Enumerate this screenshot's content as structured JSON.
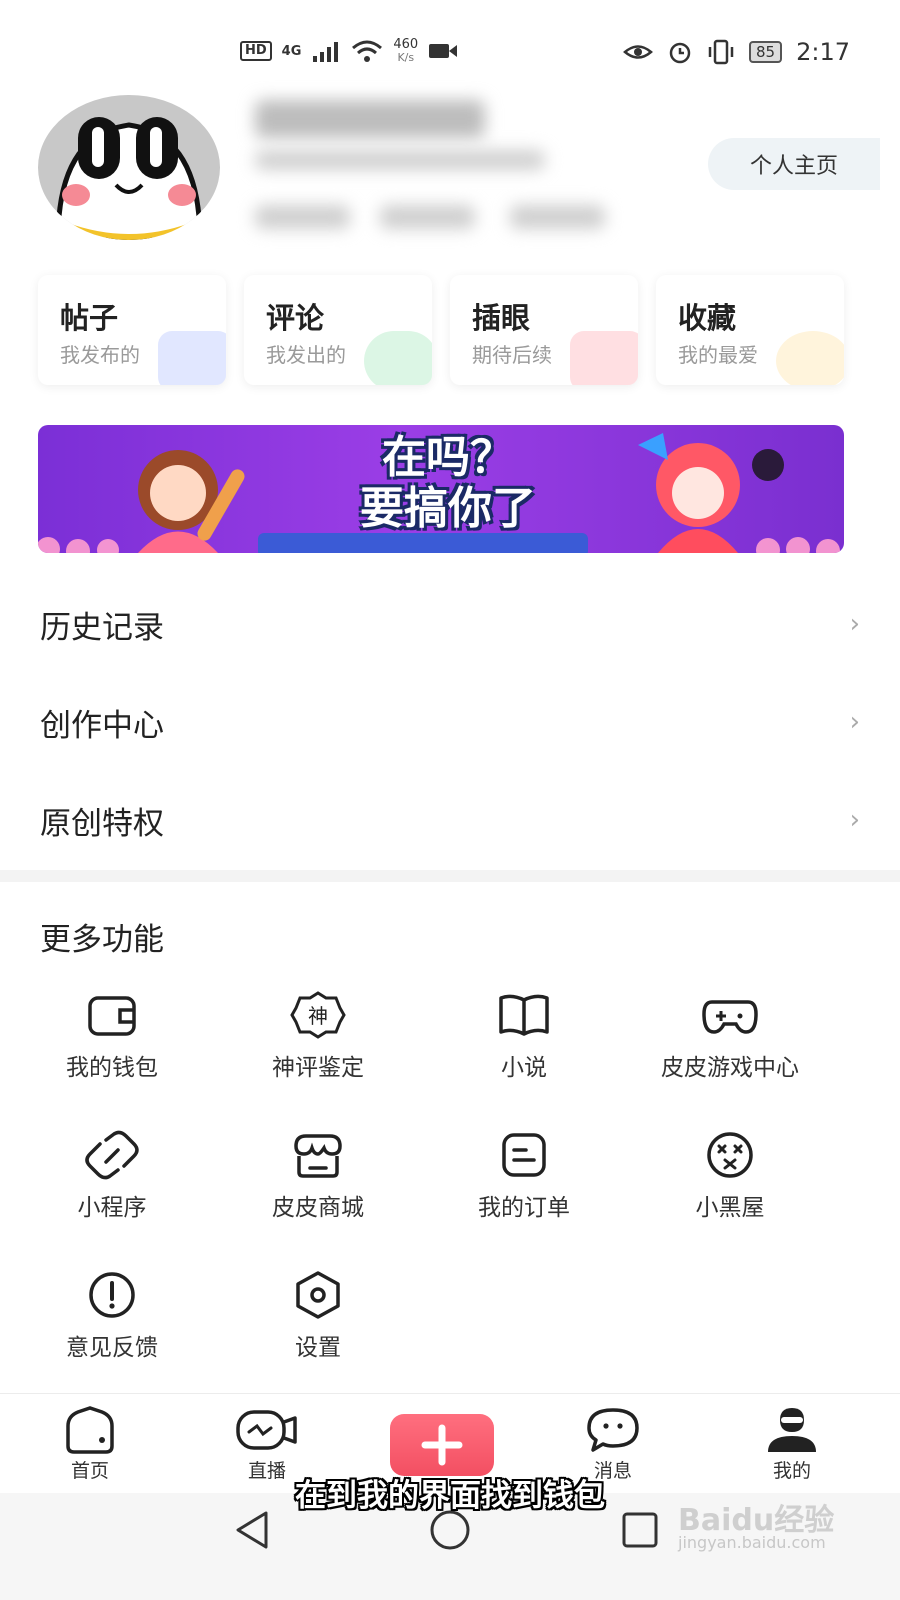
{
  "status_bar": {
    "hd": "HD",
    "network": "4G",
    "speed_value": "460",
    "speed_unit": "K/s",
    "battery": "85",
    "time": "2:17"
  },
  "profile": {
    "home_button": "个人主页"
  },
  "cards": [
    {
      "title": "帖子",
      "subtitle": "我发布的",
      "accent": "#5b7bff"
    },
    {
      "title": "评论",
      "subtitle": "我发出的",
      "accent": "#3ccf6e"
    },
    {
      "title": "插眼",
      "subtitle": "期待后续",
      "accent": "#ff4f5e"
    },
    {
      "title": "收藏",
      "subtitle": "我的最爱",
      "accent": "#ffc43d"
    }
  ],
  "banner": {
    "line1": "在吗？",
    "line2": "要搞你了"
  },
  "menu": [
    {
      "label": "历史记录"
    },
    {
      "label": "创作中心"
    },
    {
      "label": "原创特权"
    }
  ],
  "more": {
    "title": "更多功能",
    "items": [
      {
        "label": "我的钱包",
        "icon": "wallet-icon"
      },
      {
        "label": "神评鉴定",
        "icon": "shen-badge-icon",
        "glyph": "神"
      },
      {
        "label": "小说",
        "icon": "book-icon"
      },
      {
        "label": "皮皮游戏中心",
        "icon": "gamepad-icon"
      },
      {
        "label": "小程序",
        "icon": "link-icon"
      },
      {
        "label": "皮皮商城",
        "icon": "shop-icon"
      },
      {
        "label": "我的订单",
        "icon": "order-icon"
      },
      {
        "label": "小黑屋",
        "icon": "dizzy-face-icon"
      },
      {
        "label": "意见反馈",
        "icon": "exclamation-icon"
      },
      {
        "label": "设置",
        "icon": "hexagon-settings-icon"
      }
    ]
  },
  "bottom_nav": [
    {
      "label": "首页",
      "icon": "home-icon"
    },
    {
      "label": "直播",
      "icon": "live-camera-icon"
    },
    {
      "label": "消息",
      "icon": "message-icon"
    },
    {
      "label": "我的",
      "icon": "profile-icon"
    }
  ],
  "subtitle": "在到我的界面找到钱包",
  "watermark": {
    "main": "Baidu经验",
    "sub": "jingyan.baidu.com"
  },
  "colors": {
    "accent_red": "#f34f62",
    "banner_purple": "#8a35de"
  }
}
